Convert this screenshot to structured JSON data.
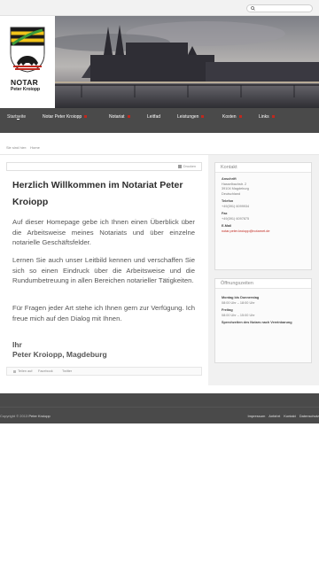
{
  "search": {
    "placeholder": ""
  },
  "logo": {
    "title": "NOTAR",
    "subtitle": "Peter Kroiopp"
  },
  "nav": {
    "items": [
      {
        "label": "Startseite",
        "has_submenu": false,
        "active": true
      },
      {
        "label": "Notar Peter Kroiopp",
        "has_submenu": true
      },
      {
        "label": "Notariat",
        "has_submenu": true
      },
      {
        "label": "Leitfad",
        "has_submenu": false
      },
      {
        "label": "Leistungen",
        "has_submenu": true
      },
      {
        "label": "Kosten",
        "has_submenu": true
      },
      {
        "label": "Links",
        "has_submenu": true
      }
    ],
    "accent_color": "#c0281e"
  },
  "breadcrumb": {
    "prefix": "Sie sind hier:",
    "current": "Home"
  },
  "toolbar": {
    "print_label": "Drucken"
  },
  "article": {
    "title": "Herzlich Willkommen im Notariat Peter Kroiopp",
    "p1": "Auf dieser Homepage gebe ich Ihnen einen Überblick über die Arbeitsweise meines Notariats und über einzelne notarielle Geschäftsfelder.",
    "p2": "Lernen Sie auch unser Leitbild kennen und verschaffen Sie sich so einen Eindruck über die Arbeitsweise und die Rundumbetreuung in allen Bereichen notarieller Tätigkeiten.",
    "p3": "Für Fragen jeder Art stehe ich Ihnen gern zur Verfügung. Ich freue mich auf den Dialog mit Ihnen.",
    "sign_line1": "Ihr",
    "sign_line2": "Peter Kroiopp, Magdeburg"
  },
  "social": [
    {
      "label": "Teilen auf:"
    },
    {
      "label": "Facebook"
    },
    {
      "label": "Twitter"
    }
  ],
  "kontakt": {
    "title": "Kontakt",
    "address_label": "Anschrift",
    "street": "Hasselbachstr. 2",
    "city": "39104 Magdeburg",
    "country": "Deutschland",
    "phone_label": "Telefon",
    "phone": "+49(391) 6099934",
    "fax_label": "Fax",
    "fax": "+49(391) 6097875",
    "email_label": "E-Mail",
    "email": "notar.peter.kroiopp@notarnet.de"
  },
  "hours": {
    "title": "Öffnungszeiten",
    "days1": "Montag bis Donnerstag",
    "time1": "08:00 Uhr – 18:00 Uhr",
    "days2": "Freitag",
    "time2": "08:00 Uhr – 15:00 Uhr",
    "note": "Sprechzeiten des Notars nach Vereinbarung"
  },
  "footer": {
    "copyright_prefix": "Copyright © 2013",
    "copyright_name": "Peter Kroiopp",
    "links": [
      "Impressum",
      "Anfahrt",
      "Kontakt",
      "Datenschutz"
    ]
  }
}
